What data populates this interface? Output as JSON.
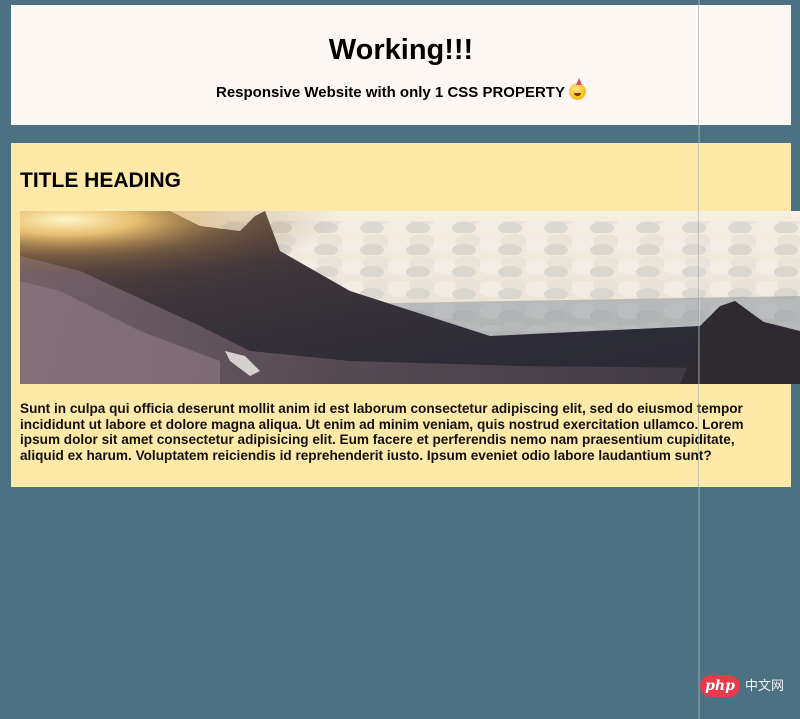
{
  "header": {
    "title": "Working!!!",
    "subtitle": "Responsive Website with only 1 CSS PROPERTY",
    "emoji_icon": "party-face-icon"
  },
  "card": {
    "heading": "TITLE HEADING",
    "image_alt": "Mountain peak above a sea of clouds at sunrise",
    "body": "Sunt in culpa qui officia deserunt mollit anim id est laborum consectetur adipiscing elit, sed do eiusmod tempor incididunt ut labore et dolore magna aliqua. Ut enim ad minim veniam, quis nostrud exercitation ullamco. Lorem ipsum dolor sit amet consectetur adipisicing elit. Eum facere et perferendis nemo nam praesentium cupiditate, aliquid ex harum. Voluptatem reiciendis id reprehenderit iusto. Ipsum eveniet odio labore laudantium sunt?"
  },
  "watermark": {
    "logo": "php",
    "text": "中文网"
  },
  "colors": {
    "page_background": "#4b7183",
    "header_background": "#fdf8f4",
    "card_background": "#fee9a9",
    "watermark_accent": "#e93a4b"
  }
}
